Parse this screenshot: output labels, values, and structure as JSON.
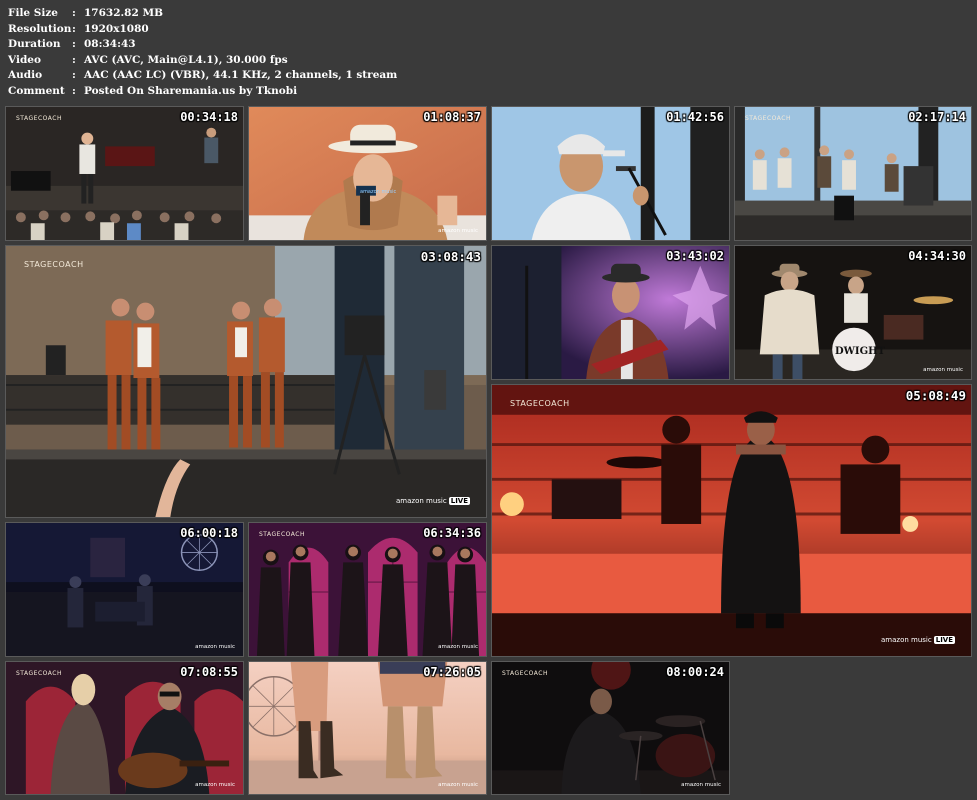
{
  "meta": {
    "rows": [
      {
        "label": "File Size",
        "value": "17632.82 MB"
      },
      {
        "label": "Resolution",
        "value": "1920x1080"
      },
      {
        "label": "Duration",
        "value": "08:34:43"
      },
      {
        "label": "Video",
        "value": "AVC (AVC, Main@L4.1), 30.000 fps"
      },
      {
        "label": "Audio",
        "value": "AAC (AAC LC) (VBR), 44.1 KHz, 2 channels, 1 stream"
      },
      {
        "label": "Comment",
        "value": "Posted On Sharemania.us by Tknobi"
      }
    ],
    "separator": ":"
  },
  "thumbs": [
    {
      "timestamp": "00:34:18",
      "watermark": "STAGECOACH"
    },
    {
      "timestamp": "01:08:37",
      "mic_label": "amazon music",
      "logo": "amazon music"
    },
    {
      "timestamp": "01:42:56"
    },
    {
      "timestamp": "02:17:14",
      "watermark": "STAGECOACH"
    },
    {
      "timestamp": "03:08:43",
      "watermark": "STAGECOACH",
      "logo": "amazon music",
      "logo_badge": "LIVE"
    },
    {
      "timestamp": "03:43:02"
    },
    {
      "timestamp": "04:34:30",
      "drum_text": "DWIGHT",
      "logo": "amazon music"
    },
    {
      "timestamp": "05:08:49",
      "watermark": "STAGECOACH",
      "logo": "amazon music",
      "logo_badge": "LIVE"
    },
    {
      "timestamp": "06:00:18",
      "logo": "amazon music"
    },
    {
      "timestamp": "06:34:36",
      "watermark": "STAGECOACH",
      "logo": "amazon music"
    },
    {
      "timestamp": "07:08:55",
      "watermark": "STAGECOACH",
      "logo": "amazon music"
    },
    {
      "timestamp": "07:26:05",
      "logo": "amazon music"
    },
    {
      "timestamp": "08:00:24",
      "watermark": "STAGECOACH",
      "logo": "amazon music"
    }
  ]
}
